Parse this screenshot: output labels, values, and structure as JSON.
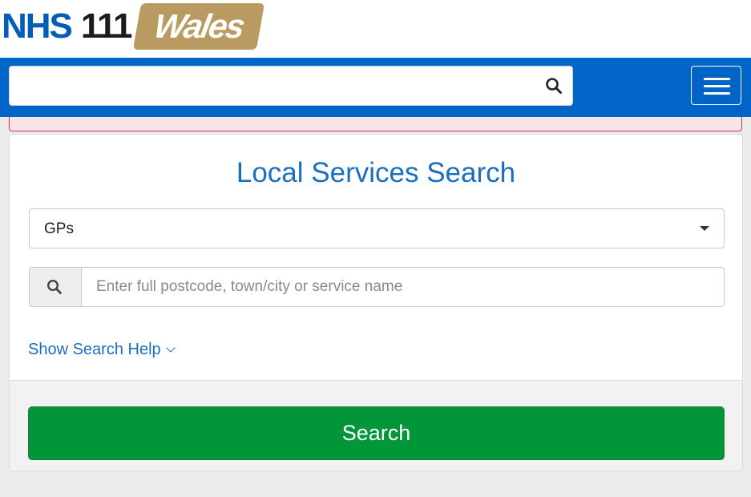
{
  "brand": {
    "nhs": "NHS",
    "number": "111",
    "region": "Wales"
  },
  "navbar": {
    "search_value": "",
    "search_icon": "search-icon",
    "menu_icon": "hamburger-menu-icon"
  },
  "local_search": {
    "title": "Local Services Search",
    "service_type": "GPs",
    "location_placeholder": "Enter full postcode, town/city or service name",
    "help_label": "Show Search Help",
    "submit_label": "Search"
  },
  "colors": {
    "nhs_blue": "#005eb8",
    "navbar_blue": "#0064c8",
    "wales_gold": "#b99a61",
    "link_blue": "#1a6fc0",
    "search_green": "#009639",
    "alert_red": "#e0334a"
  }
}
